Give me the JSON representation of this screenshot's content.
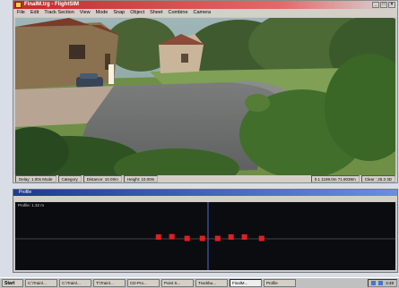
{
  "main_window": {
    "title": "FinalM.trg - FlightSIM",
    "menu": [
      "File",
      "Edit",
      "Track Section",
      "View",
      "Mode",
      "Snap",
      "Object",
      "Sheet",
      "Combine",
      "Camera"
    ]
  },
  "status_bar": {
    "items": [
      "Delay: 1.00s  Mode",
      "Category",
      "Distance: 10.00m",
      "Height: 10.00m"
    ],
    "coords": "0.1 1198.0m  71.9038m",
    "right": "Clear : 25.3 3D"
  },
  "profile_window": {
    "title": "Profile",
    "subtitle": "",
    "info": "Profile: 1.32 m",
    "points": [
      {
        "x": 0.375,
        "y": 0.5
      },
      {
        "x": 0.41,
        "y": 0.495
      },
      {
        "x": 0.45,
        "y": 0.52
      },
      {
        "x": 0.49,
        "y": 0.52
      },
      {
        "x": 0.53,
        "y": 0.52
      },
      {
        "x": 0.565,
        "y": 0.5
      },
      {
        "x": 0.6,
        "y": 0.5
      },
      {
        "x": 0.645,
        "y": 0.52
      }
    ]
  },
  "taskbar": {
    "start": "Start",
    "tasks": [
      "C:\\Train\\...",
      "C:\\Train\\...",
      "T:\\Train\\...",
      "CD-Pro...",
      "Point S...",
      "Trackbu...",
      "FinalM...",
      "Profile"
    ],
    "active_index": 6,
    "clock": "4:49"
  },
  "colors": {
    "point_color": "#e01f1f",
    "title_red": "#c8282a",
    "profile_bg": "#0b0c10"
  }
}
